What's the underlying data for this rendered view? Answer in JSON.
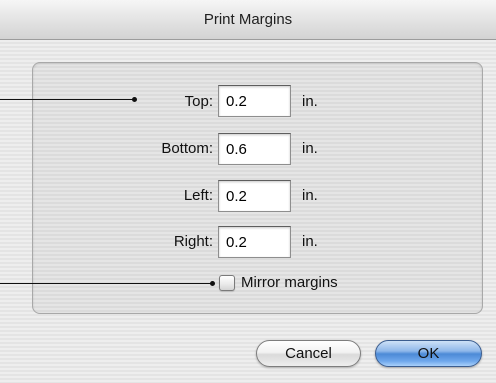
{
  "dialog": {
    "title": "Print Margins"
  },
  "fields": {
    "top": {
      "label": "Top:",
      "value": "0.2",
      "unit": "in."
    },
    "bottom": {
      "label": "Bottom:",
      "value": "0.6",
      "unit": "in."
    },
    "left": {
      "label": "Left:",
      "value": "0.2",
      "unit": "in."
    },
    "right": {
      "label": "Right:",
      "value": "0.2",
      "unit": "in."
    }
  },
  "mirror": {
    "label": "Mirror margins",
    "checked": false
  },
  "buttons": {
    "cancel": "Cancel",
    "ok": "OK"
  },
  "colors": {
    "default_button": "#4c8ad6",
    "background": "#ececec"
  }
}
